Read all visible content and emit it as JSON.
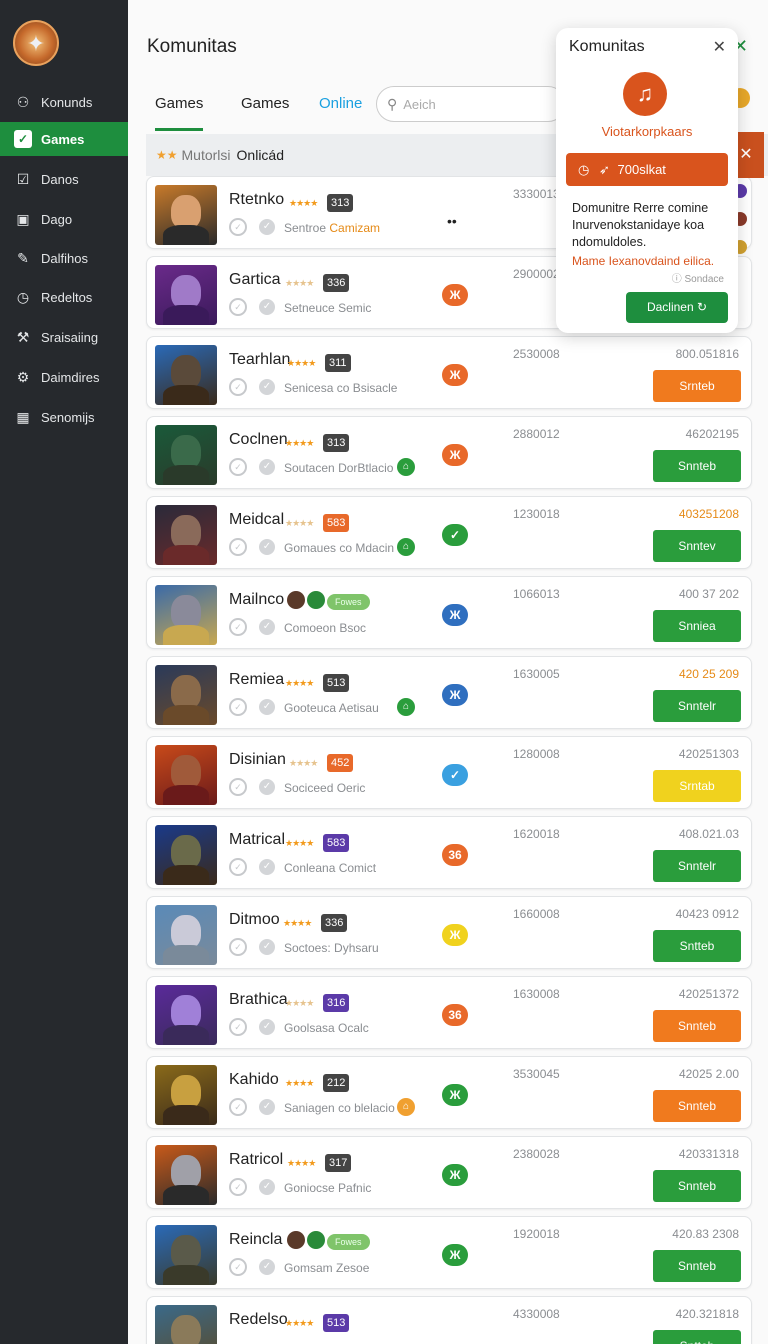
{
  "sidebar": {
    "items": [
      {
        "label": "Konunds",
        "icon": "user-icon"
      },
      {
        "label": "Games",
        "icon": "check-icon",
        "active": true
      },
      {
        "label": "Danos",
        "icon": "checkbox-icon"
      },
      {
        "label": "Dago",
        "icon": "bag-icon"
      },
      {
        "label": "Dalfihos",
        "icon": "pen-icon"
      },
      {
        "label": "Redeltos",
        "icon": "clock-icon"
      },
      {
        "label": "Sraisaiing",
        "icon": "wrench-icon"
      },
      {
        "label": "Daimdires",
        "icon": "gear-icon"
      },
      {
        "label": "Senomijs",
        "icon": "grid-icon"
      }
    ]
  },
  "header": {
    "title": "Komunitas",
    "tabs": [
      "Games",
      "Games",
      "Online"
    ],
    "search_placeholder": "Aeich"
  },
  "section": {
    "muted": "Mutorlsi",
    "label": "Onlicád"
  },
  "rows": [
    {
      "name": "Rtetnko",
      "badge": "313",
      "badge_color": "#444",
      "meta1": "Sentroe",
      "meta2": "Camizam",
      "status": "••",
      "status_color": "none",
      "time": "3330013",
      "date": "",
      "date_orange": false,
      "action": "",
      "action_color": ""
    },
    {
      "name": "Gartica",
      "badge": "336",
      "badge_color": "#444",
      "meta1": "Setneuce",
      "meta2": "Semic",
      "status": "Ж",
      "status_color": "#e8692a",
      "time": "2900002",
      "date": "",
      "date_orange": false,
      "action": "",
      "action_color": ""
    },
    {
      "name": "Tearhlan",
      "badge": "311",
      "badge_color": "#444",
      "meta1": "Senicesa",
      "meta2": "co Bsisacle",
      "status": "Ж",
      "status_color": "#e8692a",
      "time": "2530008",
      "date": "800.051816",
      "date_orange": false,
      "action": "Srnteb",
      "action_color": "#f07a1e"
    },
    {
      "name": "Coclnen",
      "badge": "313",
      "badge_color": "#444",
      "meta1": "Soutacen",
      "meta2": "DorBtlacio",
      "status": "Ж",
      "status_color": "#e8692a",
      "time": "2880012",
      "date": "46202195",
      "date_orange": false,
      "action": "Snnteb",
      "action_color": "#2a9d3c"
    },
    {
      "name": "Meidcal",
      "badge": "583",
      "badge_color": "#e8692a",
      "meta1": "Gomaues",
      "meta2": "co Mdacin",
      "status": "✓",
      "status_color": "#2a9d3c",
      "time": "1230018",
      "date": "403251208",
      "date_orange": true,
      "action": "Snntev",
      "action_color": "#2a9d3c"
    },
    {
      "name": "Mailnco",
      "badge": "",
      "badge_color": "",
      "meta1": "Comoeon",
      "meta2": "Bsoc",
      "status": "Ж",
      "status_color": "#2f6fbf",
      "time": "1066013",
      "date": "400 37 202",
      "date_orange": false,
      "action": "Snniea",
      "action_color": "#2a9d3c"
    },
    {
      "name": "Remiea",
      "badge": "513",
      "badge_color": "#444",
      "meta1": "Gooteuca",
      "meta2": "Aetisau",
      "status": "Ж",
      "status_color": "#2f6fbf",
      "time": "1630005",
      "date": "420 25 209",
      "date_orange": true,
      "action": "Snntelr",
      "action_color": "#2a9d3c"
    },
    {
      "name": "Disinian",
      "badge": "452",
      "badge_color": "#e8692a",
      "meta1": "Sociceed",
      "meta2": "Oeric",
      "status": "✓",
      "status_color": "#3aa0e0",
      "time": "1280008",
      "date": "420251303",
      "date_orange": false,
      "action": "Srntab",
      "action_color": "#f0d21e"
    },
    {
      "name": "Matrical",
      "badge": "583",
      "badge_color": "#5b3aa8",
      "meta1": "Conleana",
      "meta2": "Comict",
      "status": "36",
      "status_color": "#e8692a",
      "time": "1620018",
      "date": "408.021.03",
      "date_orange": false,
      "action": "Snntelr",
      "action_color": "#2a9d3c"
    },
    {
      "name": "Ditmoo",
      "badge": "336",
      "badge_color": "#444",
      "meta1": "Soctoes:",
      "meta2": "Dyhsaru",
      "status": "Ж",
      "status_color": "#f0d21e",
      "time": "1660008",
      "date": "40423 0912",
      "date_orange": false,
      "action": "Sntteb",
      "action_color": "#2a9d3c"
    },
    {
      "name": "Brathica",
      "badge": "316",
      "badge_color": "#5b3aa8",
      "meta1": "Goolsasa",
      "meta2": "Ocalc",
      "status": "36",
      "status_color": "#e8692a",
      "time": "1630008",
      "date": "420251372",
      "date_orange": false,
      "action": "Snnteb",
      "action_color": "#f07a1e"
    },
    {
      "name": "Kahido",
      "badge": "212",
      "badge_color": "#444",
      "meta1": "Saniagen",
      "meta2": "co blelacio",
      "status": "Ж",
      "status_color": "#2a9d3c",
      "time": "3530045",
      "date": "42025 2.00",
      "date_orange": false,
      "action": "Snnteb",
      "action_color": "#f07a1e"
    },
    {
      "name": "Ratricol",
      "badge": "317",
      "badge_color": "#444",
      "meta1": "Goniocse",
      "meta2": "Pafnic",
      "status": "Ж",
      "status_color": "#2a9d3c",
      "time": "2380028",
      "date": "420331318",
      "date_orange": false,
      "action": "Snnteb",
      "action_color": "#2a9d3c"
    },
    {
      "name": "Reincla",
      "badge": "",
      "badge_color": "",
      "meta1": "Gomsam",
      "meta2": "Zesoe",
      "status": "Ж",
      "status_color": "#2a9d3c",
      "time": "1920018",
      "date": "420.83 2308",
      "date_orange": false,
      "action": "Snnteb",
      "action_color": "#2a9d3c"
    },
    {
      "name": "Redelso",
      "badge": "513",
      "badge_color": "#5b3aa8",
      "meta1": "",
      "meta2": "",
      "status": "",
      "status_color": "none",
      "time": "4330008",
      "date": "420.321818",
      "date_orange": false,
      "action": "Sntteb",
      "action_color": "#2a9d3c"
    }
  ],
  "row_tags": {
    "5": "Fowes",
    "13": "Fowes"
  },
  "popup": {
    "title": "Komunitas",
    "subtitle": "Viotarkorpkaars",
    "cta": "700slkat",
    "body": "Domunitre Rerre comine Inurvenokstanidaye koa ndomuldoles.",
    "link": "Mame Iexanovdaind eilica.",
    "note": "Sondace",
    "button": "Daclinen"
  },
  "colors": {
    "brand": "#1e8e3e",
    "sidebar": "#26292d",
    "orange": "#e8692a",
    "link": "#1aa0e0"
  }
}
